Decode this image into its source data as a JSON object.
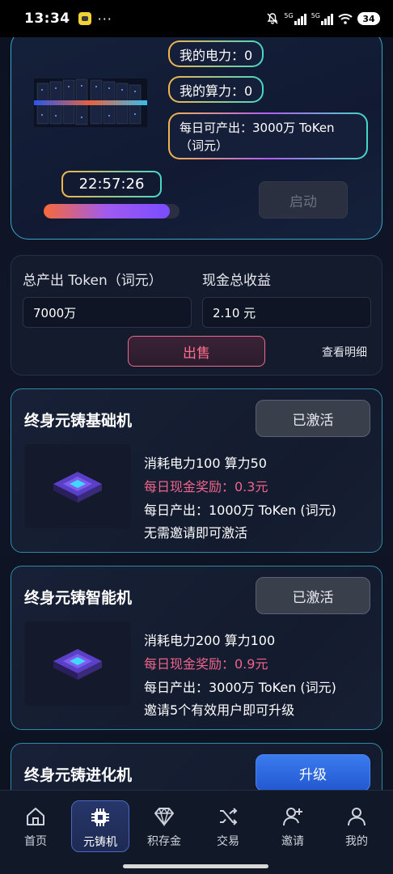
{
  "status_bar": {
    "time": "13:34",
    "dots": "···",
    "network1": "5G",
    "network2": "5G",
    "battery": "34",
    "icons": [
      "app-notification-icon",
      "mute-icon",
      "signal-icon",
      "signal-icon",
      "wifi-icon",
      "battery-icon"
    ]
  },
  "top_card": {
    "my_power": "我的电力：0",
    "my_compute": "我的算力：0",
    "daily_output": "每日可产出：3000万 ToKen（词元）",
    "timer": "22:57:26",
    "progress": 0.93,
    "start_button": "启动"
  },
  "summary": {
    "total_token_label": "总产出 Token（词元）",
    "cash_income_label": "现金总收益",
    "total_token_value": "7000万",
    "cash_income_value": "2.10 元",
    "sell_button": "出售",
    "detail_link": "查看明细"
  },
  "machines": [
    {
      "title": "终身元铸基础机",
      "button": "已激活",
      "button_state": "activated",
      "cost": "消耗电力100 算力50",
      "reward": "每日现金奖励：0.3元",
      "output": "每日产出：1000万 ToKen (词元)",
      "condition": "无需邀请即可激活"
    },
    {
      "title": "终身元铸智能机",
      "button": "已激活",
      "button_state": "activated",
      "cost": "消耗电力200 算力100",
      "reward": "每日现金奖励：0.9元",
      "output": "每日产出：3000万 ToKen (词元)",
      "condition": "邀请5个有效用户即可升级"
    },
    {
      "title": "终身元铸进化机",
      "button": "升级",
      "button_state": "upgrade"
    }
  ],
  "nav": {
    "items": [
      {
        "label": "首页",
        "icon": "home-icon"
      },
      {
        "label": "元铸机",
        "icon": "chip-icon",
        "active": true
      },
      {
        "label": "积存金",
        "icon": "diamond-icon"
      },
      {
        "label": "交易",
        "icon": "shuffle-icon"
      },
      {
        "label": "邀请",
        "icon": "add-user-icon"
      },
      {
        "label": "我的",
        "icon": "user-icon"
      }
    ]
  },
  "colors": {
    "accent_red": "#f0648a",
    "upgrade_blue": "#2f6ae0",
    "card_border": "#2d8aa6"
  }
}
